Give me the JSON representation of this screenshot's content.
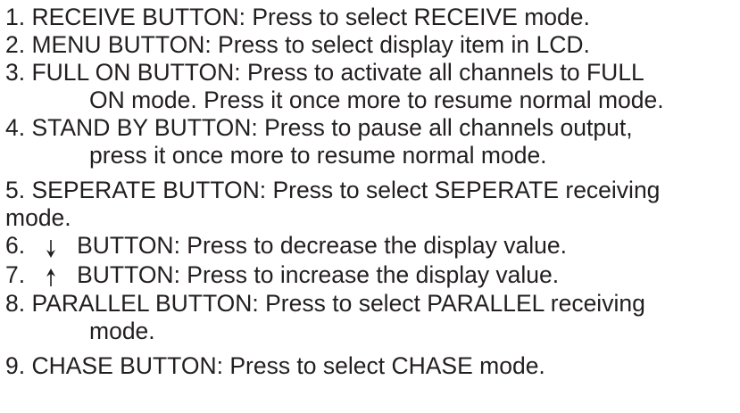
{
  "items": [
    {
      "num": "1.",
      "lines": [
        "RECEIVE BUTTON: Press to select RECEIVE mode."
      ]
    },
    {
      "num": "2.",
      "lines": [
        "MENU BUTTON: Press to select display item in LCD."
      ]
    },
    {
      "num": "3.",
      "lines": [
        "FULL ON BUTTON: Press to activate all channels to FULL",
        "ON mode. Press it once more to resume normal mode."
      ]
    },
    {
      "num": "4.",
      "lines": [
        "STAND BY BUTTON: Press to pause all channels output,",
        "press it once more to resume normal mode."
      ]
    },
    {
      "num": "5.",
      "lines": [
        "SEPERATE BUTTON: Press to select SEPERATE receiving",
        "mode."
      ]
    },
    {
      "num": "6.",
      "icon": "down-arrow-icon",
      "lines": [
        "BUTTON: Press to decrease the display value."
      ]
    },
    {
      "num": "7.",
      "icon": "up-arrow-icon",
      "lines": [
        "BUTTON: Press to increase the display value."
      ]
    },
    {
      "num": "8.",
      "lines": [
        "PARALLEL BUTTON: Press to select PARALLEL receiving",
        "mode."
      ]
    },
    {
      "num": "9.",
      "lines": [
        "CHASE BUTTON: Press to select CHASE mode."
      ]
    }
  ]
}
